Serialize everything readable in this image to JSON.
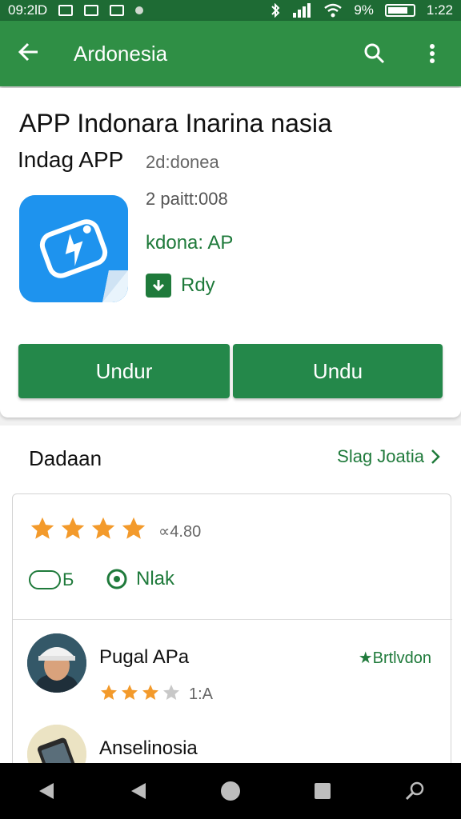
{
  "statusbar": {
    "time_left": "09:2lD",
    "time": "1:22",
    "battery": "9%"
  },
  "appbar": {
    "title": "Ardonesia"
  },
  "app": {
    "title": "APP Indonara Inarina nasia",
    "developer": "Indag APP",
    "region": "2d:donea",
    "size": "2 paitt:008",
    "link": "kdona: AP",
    "badge": "Rdy"
  },
  "buttons": {
    "primary": "Undur",
    "secondary": "Undu"
  },
  "reviews": {
    "title": "Dadaan",
    "see_all": "Slag Joatia",
    "summary_rating": 4,
    "summary_value": "∝4.80",
    "chip_a": "Б",
    "chip_b": "Nlak",
    "items": [
      {
        "name": "Pugal APa",
        "rating": 3,
        "label": "1:A",
        "link": "★Brtlvdon"
      },
      {
        "name": "Anselinosia"
      }
    ]
  },
  "colors": {
    "primary": "#2f8f45",
    "button": "#24884a",
    "app_icon": "#1e93ee",
    "star": "#f39a2b"
  }
}
